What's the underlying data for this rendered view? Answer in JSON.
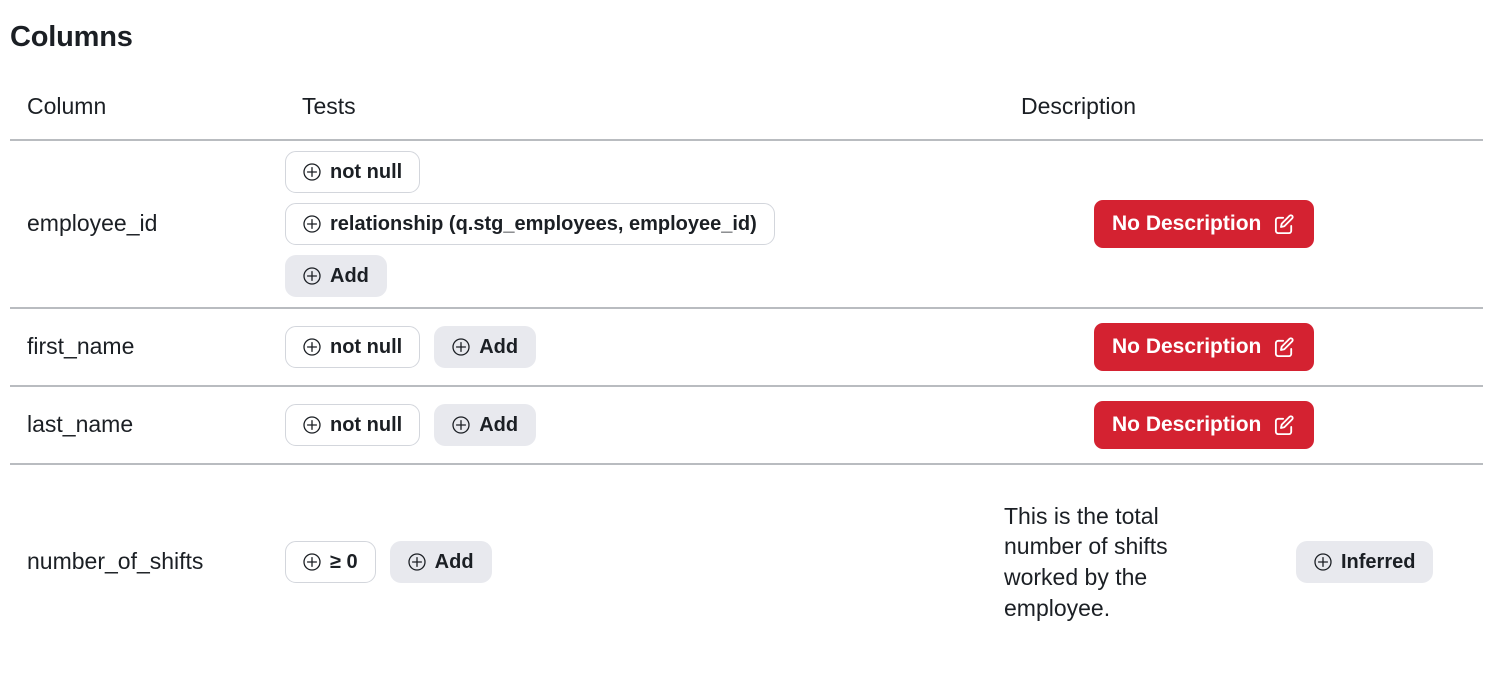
{
  "page": {
    "title": "Columns"
  },
  "table": {
    "headers": {
      "column": "Column",
      "tests": "Tests",
      "description": "Description"
    },
    "add_label": "Add",
    "no_description_label": "No Description",
    "inferred_label": "Inferred",
    "rows": [
      {
        "column": "employee_id",
        "layout": "stacked",
        "tests": [
          "not null",
          "relationship (q.stg_employees, employee_id)"
        ],
        "description": "",
        "description_state": "No Description"
      },
      {
        "column": "first_name",
        "layout": "inline",
        "tests": [
          "not null"
        ],
        "description": "",
        "description_state": "No Description"
      },
      {
        "column": "last_name",
        "layout": "inline",
        "tests": [
          "not null"
        ],
        "description": "",
        "description_state": "No Description"
      },
      {
        "column": "number_of_shifts",
        "layout": "inline",
        "tests": [
          "≥ 0"
        ],
        "description": "This is the total number of shifts worked by the employee.",
        "description_state": "Inferred"
      }
    ]
  },
  "colors": {
    "danger": "#d42231",
    "badge_bg": "#e8e9ee",
    "border": "#b9bcc0",
    "text": "#1b1f24"
  },
  "icons": {
    "plus_circle": "plus-circle-icon",
    "edit_square": "edit-square-icon"
  }
}
